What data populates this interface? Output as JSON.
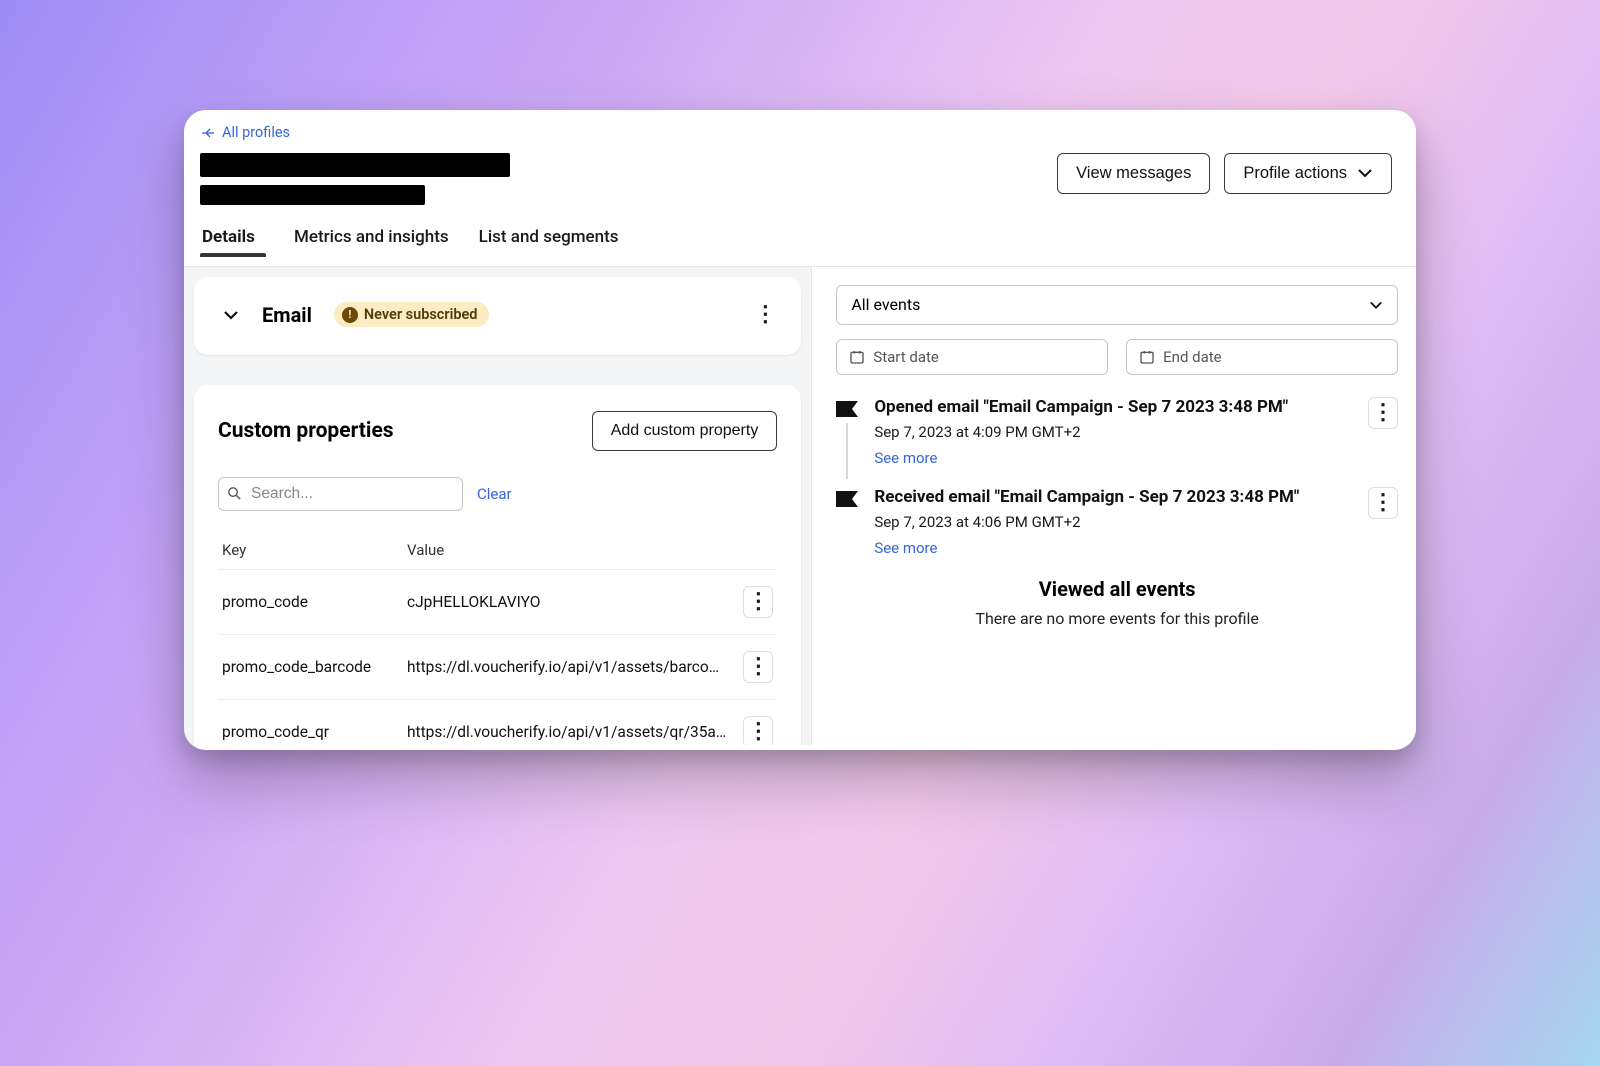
{
  "header": {
    "back_label": "All profiles",
    "view_messages": "View messages",
    "profile_actions": "Profile actions"
  },
  "tabs": [
    "Details",
    "Metrics and insights",
    "List and segments"
  ],
  "email_card": {
    "label": "Email",
    "badge": "Never subscribed"
  },
  "props": {
    "title": "Custom properties",
    "add_button": "Add custom property",
    "search_placeholder": "Search...",
    "clear_label": "Clear",
    "head_key": "Key",
    "head_value": "Value",
    "rows": [
      {
        "key": "promo_code",
        "value": "cJpHELLOKLAVIYO"
      },
      {
        "key": "promo_code_barcode",
        "value": "https://dl.voucherify.io/api/v1/assets/barco…"
      },
      {
        "key": "promo_code_qr",
        "value": "https://dl.voucherify.io/api/v1/assets/qr/35a…"
      }
    ]
  },
  "events_panel": {
    "filter_label": "All events",
    "start_placeholder": "Start date",
    "end_placeholder": "End date",
    "see_more": "See more",
    "events": [
      {
        "title": "Opened email \"Email Campaign - Sep 7 2023 3:48 PM\"",
        "time": "Sep 7, 2023 at 4:09 PM GMT+2"
      },
      {
        "title": "Received email \"Email Campaign - Sep 7 2023 3:48 PM\"",
        "time": "Sep 7, 2023 at 4:06 PM GMT+2"
      }
    ],
    "footer_title": "Viewed all events",
    "footer_text": "There are no more events for this profile"
  }
}
